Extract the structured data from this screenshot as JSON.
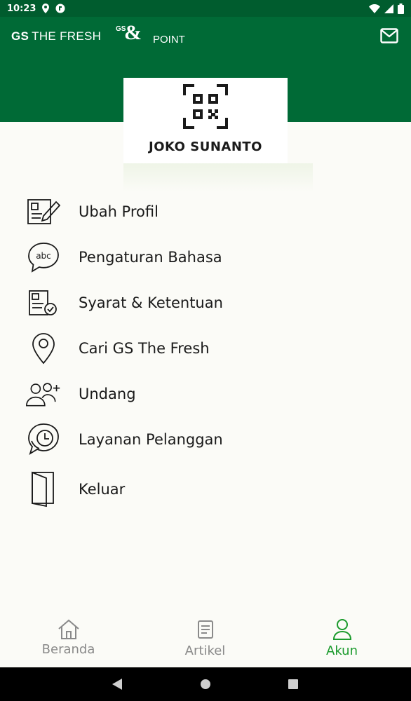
{
  "status_bar": {
    "time": "10:23"
  },
  "header": {
    "brand_prefix": "GS",
    "brand_name": "THE FRESH",
    "point_logo_gs": "GS",
    "point_logo_amp": "&",
    "point_logo_text": "POINT",
    "bg_color": "#006a36"
  },
  "profile": {
    "name": "JOKO SUNANTO"
  },
  "menu": {
    "items": [
      {
        "label": "Ubah Profil",
        "icon": "edit-profile-icon"
      },
      {
        "label": "Pengaturan Bahasa",
        "icon": "language-abc-icon"
      },
      {
        "label": "Syarat & Ketentuan",
        "icon": "terms-document-icon"
      },
      {
        "label": "Cari GS The Fresh",
        "icon": "location-pin-icon"
      },
      {
        "label": "Undang",
        "icon": "invite-users-icon"
      },
      {
        "label": "Layanan Pelanggan",
        "icon": "customer-service-icon"
      },
      {
        "label": "Keluar",
        "icon": "logout-door-icon"
      }
    ]
  },
  "bottom_nav": {
    "tabs": [
      {
        "label": "Beranda",
        "icon": "home-icon"
      },
      {
        "label": "Artikel",
        "icon": "article-icon"
      },
      {
        "label": "Akun",
        "icon": "account-icon",
        "active": true
      }
    ],
    "active_color": "#1a9a2c",
    "inactive_color": "#8a8a8a"
  }
}
